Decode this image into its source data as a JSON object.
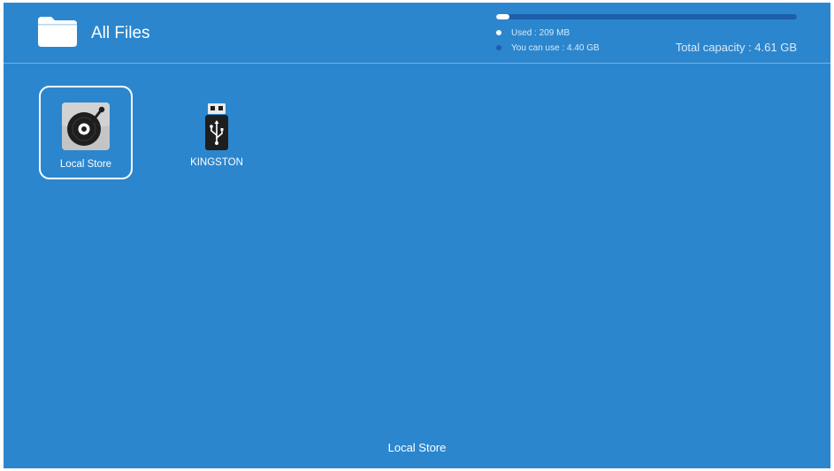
{
  "header": {
    "title": "All Files",
    "folder_icon": "folder-icon"
  },
  "storage": {
    "used_fraction": 0.045,
    "used_label": "Used : 209 MB",
    "available_label": "You can use : 4.40 GB",
    "total_label": "Total capacity : 4.61 GB",
    "colors": {
      "used": "#ffffff",
      "available": "#1d5fa8"
    }
  },
  "devices": [
    {
      "label": "Local Store",
      "icon": "disc-drive-icon",
      "selected": true
    },
    {
      "label": "KINGSTON",
      "icon": "usb-drive-icon",
      "selected": false
    }
  ],
  "status": {
    "text": "Local Store"
  },
  "colors": {
    "background": "#2b86ce",
    "accent": "#ffffff"
  }
}
